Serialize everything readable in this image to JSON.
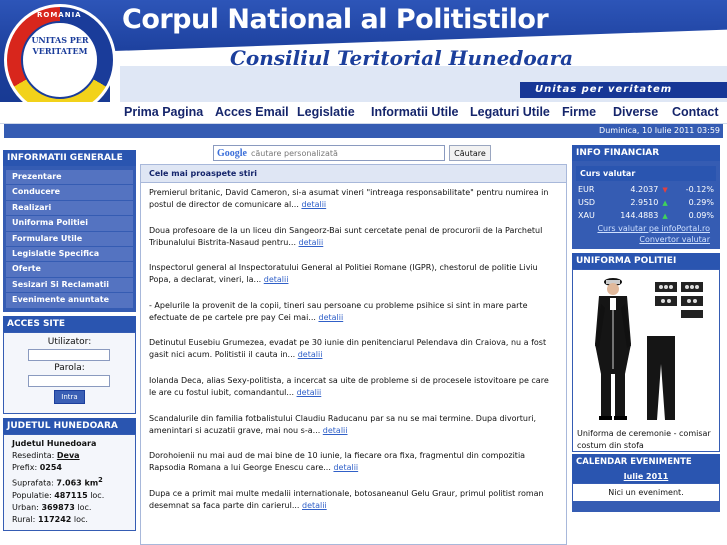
{
  "header": {
    "logo_top": "ROMANIA",
    "logo_text": "UNITAS PER VERITATEM",
    "title": "Corpul National al Politistilor",
    "subtitle": "Consiliul Teritorial Hunedoara",
    "motto": "Unitas per veritatem"
  },
  "nav": [
    "Prima Pagina",
    "Acces Email",
    "Legislatie",
    "Informatii Utile",
    "Legaturi Utile",
    "Firme",
    "Diverse",
    "Contact"
  ],
  "date_text": "Duminica, 10 Iulie 2011 03:59",
  "left": {
    "info_title": "INFORMATII GENERALE",
    "info_items": [
      "Prezentare",
      "Conducere",
      "Realizari",
      "Uniforma Politiei",
      "Formulare Utile",
      "Legislatie Specifica",
      "Oferte",
      "Sesizari Si Reclamatii",
      "Evenimente anuntate"
    ],
    "acces_title": "ACCES SITE",
    "user_label": "Utilizator:",
    "pass_label": "Parola:",
    "login_label": "Intra",
    "judet_title": "JUDETUL HUNEDOARA",
    "judet_rows": {
      "r1": "Judetul Hunedoara",
      "r2_label": "Resedinta:",
      "r2_value": "Deva",
      "r3_label": "Prefix:",
      "r3_value": "0254",
      "r4_label": "Suprafata:",
      "r4_value": "7.063 km",
      "r4_sup": "2",
      "r5_label": "Populatie:",
      "r5_value": "487115",
      "r5_unit": "loc.",
      "r6_label": "Urban:",
      "r6_value": "369873",
      "r6_unit": "loc.",
      "r7_label": "Rural:",
      "r7_value": "117242",
      "r7_unit": "loc."
    }
  },
  "search": {
    "google": "Google",
    "placeholder": "căutare personalizată",
    "button": "Căutare"
  },
  "news": {
    "title": "Cele mai proaspete stiri",
    "more": "detalii",
    "items": [
      "Premierul britanic, David Cameron, si-a asumat vineri \"intreaga responsabilitate\" pentru numirea in postul de director de comunicare al...",
      "Doua profesoare de la un liceu din Sangeorz-Bai sunt cercetate penal de procurorii de la Parchetul Tribunalului Bistrita-Nasaud pentru...",
      "Inspectorul general al Inspectoratului General al Politiei Romane (IGPR), chestorul de politie Liviu Popa, a declarat, vineri, la...",
      "- Apelurile la provenit de la copii, tineri sau persoane cu probleme psihice si sint in mare parte efectuate de pe cartele pre pay Cei mai...",
      "Detinutul Eusebiu Grumezea, evadat pe 30 iunie din penitenciarul Pelendava din Craiova, nu a fost gasit nici acum. Politistii il cauta in...",
      "Iolanda Deca, alias Sexy-politista, a incercat sa uite de probleme si de procesele istovitoare pe care le are cu fostul iubit, comandantul...",
      "Scandalurile din familia fotbalistului Claudiu Raducanu par sa nu se mai termine. Dupa divorturi, amenintari si acuzatii grave, mai nou s-a...",
      "Dorohoienii nu mai aud de mai bine de 10 iunie, la fiecare ora fixa, fragmentul din compozitia Rapsodia Romana a lui George Enescu care...",
      "Dupa ce a primit mai multe medalii internationale, botosaneanul Gelu Graur, primul politist roman desemnat sa faca parte din carierul..."
    ]
  },
  "right": {
    "fin_title": "INFO FINANCIAR",
    "fin_sub": "Curs valutar",
    "rates": [
      {
        "cur": "EUR",
        "val": "4.2037",
        "dir": "down",
        "chg": "-0.12%"
      },
      {
        "cur": "USD",
        "val": "2.9510",
        "dir": "up",
        "chg": "0.29%"
      },
      {
        "cur": "XAU",
        "val": "144.4883",
        "dir": "up",
        "chg": "0.09%"
      }
    ],
    "fin_link1": "Curs valutar pe infoPortal.ro",
    "fin_link2": "Convertor valutar",
    "uniform_title": "UNIFORMA POLITIEI",
    "uniform_caption": "Uniforma de ceremonie - comisar costum din stofa",
    "cal_title": "CALENDAR EVENIMENTE",
    "cal_month": "Iulie 2011",
    "cal_empty": "Nici un eveniment."
  },
  "colors": {
    "header_blue": "#1c3f9c",
    "panel_blue": "#355cb3",
    "link_blue": "#3060c8",
    "up_green": "#3fd25a",
    "down_red": "#e04141"
  }
}
